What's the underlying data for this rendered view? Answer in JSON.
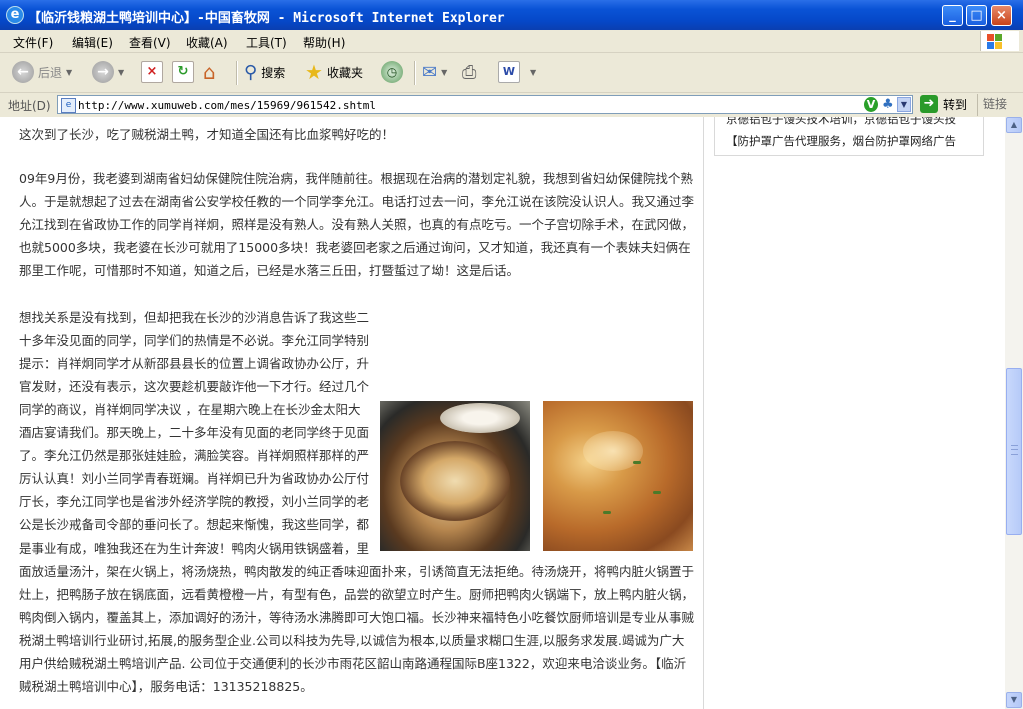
{
  "window": {
    "title": "【临沂钱粮湖土鸭培训中心】-中国畜牧网 - Microsoft Internet Explorer",
    "min": "_",
    "max": "□",
    "close": "×"
  },
  "menu": [
    "文件(F)",
    "编辑(E)",
    "查看(V)",
    "收藏(A)",
    "工具(T)",
    "帮助(H)"
  ],
  "toolbar": {
    "back": "后退",
    "search": "搜索",
    "favorites": "收藏夹"
  },
  "address": {
    "label": "地址(D)",
    "url": "http://www.xumuweb.com/mes/15969/961542.shtml",
    "go": "转到",
    "links": "链接"
  },
  "sidebar": {
    "items": [
      "京德铝包子馒头技术培训，京德铝包子馒头技",
      "【防护罩广告代理服务，烟台防护罩网络广告"
    ]
  },
  "article": {
    "p1": "这次到了长沙，吃了贼税湖土鸭，才知道全国还有比血浆鸭好吃的！",
    "p2": "09年9月份，我老婆到湖南省妇幼保健院住院治病，我伴随前往。根据现在治病的潜划定礼貌，我想到省妇幼保健院找个熟人。于是就想起了过去在湖南省公安学校任教的一个同学李允江。电话打过去一问，李允江说在该院没认识人。我又通过李允江找到在省政协工作的同学肖祥炯，照样是没有熟人。没有熟人关照，也真的有点吃亏。一个子宫切除手术，在武冈做，也就5000多块，我老婆在长沙可就用了15000多块！我老婆回老家之后通过询问，又才知道，我还真有一个表妹夫妇俩在那里工作呢，可惜那时不知道，知道之后，已经是水落三丘田，打暨蜇过了坳！这是后话。",
    "p3": "想找关系是没有找到，但却把我在长沙的沙消息告诉了我这些二十多年没见面的同学，同学们的热情是不必说。李允江同学特别提示：肖祥炯同学才从新邵县县长的位置上调省政协办公厅，升官发财，还没有表示，这次要趁机要敲诈他一下才行。经过几个同学的商议，肖祥炯同学决议 ，在星期六晚上在长沙金太阳大酒店宴请我们。那天晚上，二十多年没有见面的老同学终于见面了。李允江仍然是那张娃娃脸，满脸笑容。肖祥炯照样那样的严厉认认真！刘小兰同学青春斑斓。肖祥炯已升为省政协办公厅付厅长，李允江同学也是省涉外经济学院的教授，刘小兰同学的老公是长沙戒备司令部的垂问长了。想起来惭愧，我这些同学，都是事业有成，唯独我还在为生计奔波！鸭肉火锅用铁锅盛着，里面放适量汤汁，架在火锅上，将汤烧热，鸭肉散发的纯正香味迎面扑来，引诱简直无法拒绝。待汤烧开，将鸭内脏火锅置于灶上，把鸭肠子放在锅底面，远看黄橙橙一片，有型有色，品尝的欲望立时产生。厨师把鸭肉火锅端下，放上鸭内脏火锅，鸭肉倒入锅内，覆盖其上，添加调好的汤汁，等待汤水沸腾即可大饱口福。长沙神来福特色小吃餐饮厨师培训是专业从事贼税湖土鸭培训行业研讨,拓展,的服务型企业.公司以科技为先导,以诚信为根本,以质量求糊口生涯,以服务求发展.竭诚为广大用户供给贼税湖土鸭培训产品. 公司位于交通便利的长沙市雨花区韶山南路通程国际B座1322，欢迎来电洽谈业务。【临沂贼税湖土鸭培训中心】，服务电话：13135218825。"
  }
}
